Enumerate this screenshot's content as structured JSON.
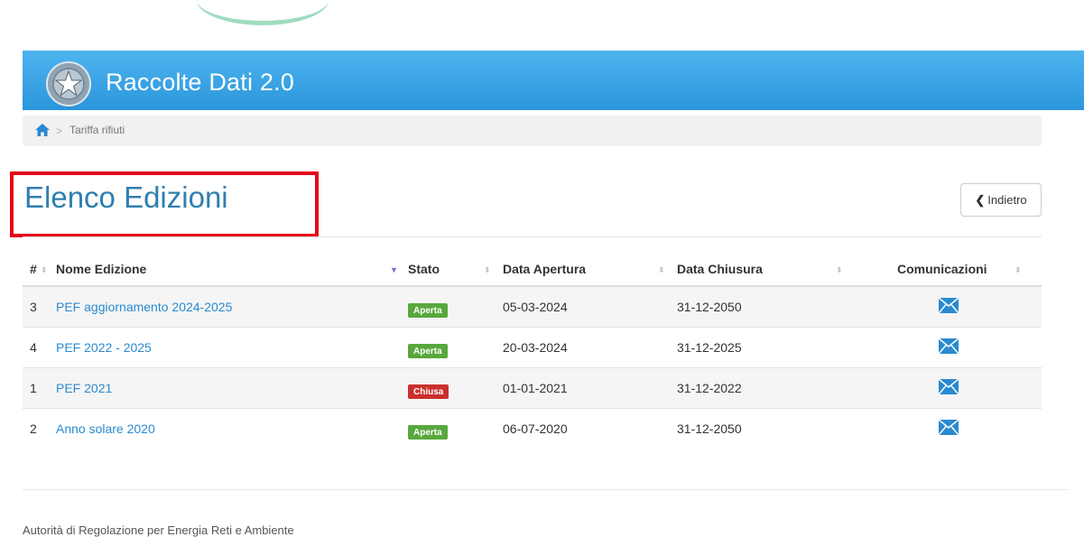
{
  "header": {
    "title": "Raccolte Dati 2.0"
  },
  "breadcrumb": {
    "separator": ">",
    "current": "Tariffa rifiuti"
  },
  "page": {
    "title": "Elenco Edizioni",
    "back_label": "Indietro"
  },
  "table": {
    "columns": [
      "#",
      "Nome Edizione",
      "Stato",
      "Data Apertura",
      "Data Chiusura",
      "Comunicazioni"
    ],
    "rows": [
      {
        "num": "3",
        "name": "PEF aggiornamento 2024-2025",
        "status": "Aperta",
        "status_color": "#58a83d",
        "opening": "05-03-2024",
        "closing": "31-12-2050",
        "comm_icon": "envelope-icon"
      },
      {
        "num": "4",
        "name": "PEF 2022 - 2025",
        "status": "Aperta",
        "status_color": "#58a83d",
        "opening": "20-03-2024",
        "closing": "31-12-2025",
        "comm_icon": "envelope-icon"
      },
      {
        "num": "1",
        "name": "PEF 2021",
        "status": "Chiusa",
        "status_color": "#c9302c",
        "opening": "01-01-2021",
        "closing": "31-12-2022",
        "comm_icon": "envelope-icon"
      },
      {
        "num": "2",
        "name": "Anno solare 2020",
        "status": "Aperta",
        "status_color": "#58a83d",
        "opening": "06-07-2020",
        "closing": "31-12-2050",
        "comm_icon": "envelope-icon"
      }
    ]
  },
  "footer": {
    "text": "Autorità di Regolazione per Energia Reti e Ambiente"
  },
  "colors": {
    "header_blue": "#3aa3e6",
    "title_blue": "#2f7fb0",
    "link_blue": "#2a8ad0",
    "highlight_red": "#e5001a"
  }
}
